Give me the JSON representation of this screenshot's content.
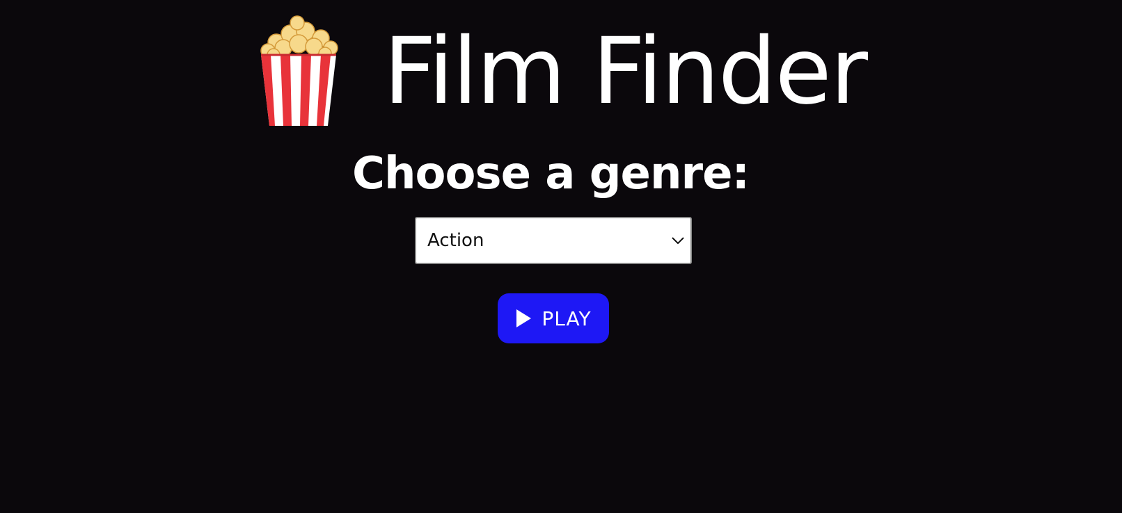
{
  "app": {
    "title": "Film Finder",
    "logo_icon": "popcorn-icon"
  },
  "genre_picker": {
    "heading": "Choose a genre:",
    "selected_value": "Action",
    "dropdown_icon": "chevron-down-icon"
  },
  "play_button": {
    "label": "PLAY",
    "icon": "play-icon",
    "color": "#1e18f5"
  },
  "colors": {
    "background": "#0b080c",
    "text": "#ffffff"
  }
}
